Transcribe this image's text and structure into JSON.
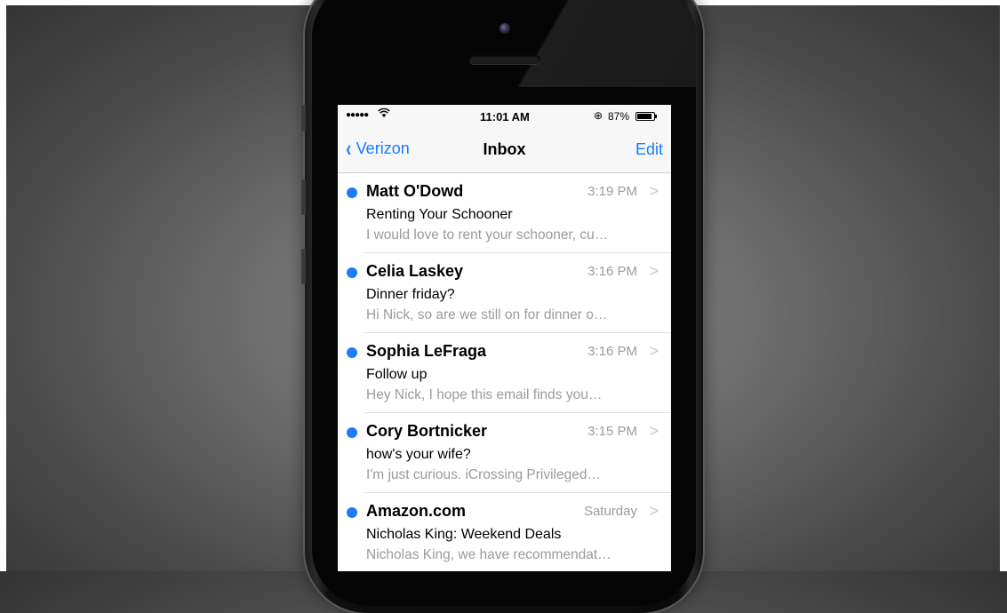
{
  "status_bar": {
    "signal": "●●●●●",
    "wifi_icon": "wifi-icon",
    "time": "11:01 AM",
    "lock_icon": "⊕",
    "battery_percent": "87%",
    "battery_level": 0.87
  },
  "nav": {
    "back_label": "Verizon",
    "back_icon": "‹",
    "title": "Inbox",
    "edit_label": "Edit"
  },
  "messages": [
    {
      "sender": "Matt O'Dowd",
      "date": "3:19 PM",
      "subject": "Renting Your Schooner",
      "preview": "I would love to rent your schooner, cu…",
      "unread": true
    },
    {
      "sender": "Celia Laskey",
      "date": "3:16 PM",
      "subject": "Dinner friday?",
      "preview": "Hi Nick, so are we still on for dinner o…",
      "unread": true
    },
    {
      "sender": "Sophia LeFraga",
      "date": "3:16 PM",
      "subject": "Follow up",
      "preview": "Hey Nick, I hope this email finds you…",
      "unread": true
    },
    {
      "sender": "Cory Bortnicker",
      "date": "3:15 PM",
      "subject": "how's your wife?",
      "preview": "I'm just curious. iCrossing Privileged…",
      "unread": true
    },
    {
      "sender": "Amazon.com",
      "date": "Saturday",
      "subject": "Nicholas King: Weekend Deals",
      "preview": "Nicholas King, we have recommendat…",
      "unread": true
    }
  ],
  "colors": {
    "accent": "#157efb",
    "unread_dot": "#1f7bf3",
    "secondary_text": "#9b9b9b"
  }
}
